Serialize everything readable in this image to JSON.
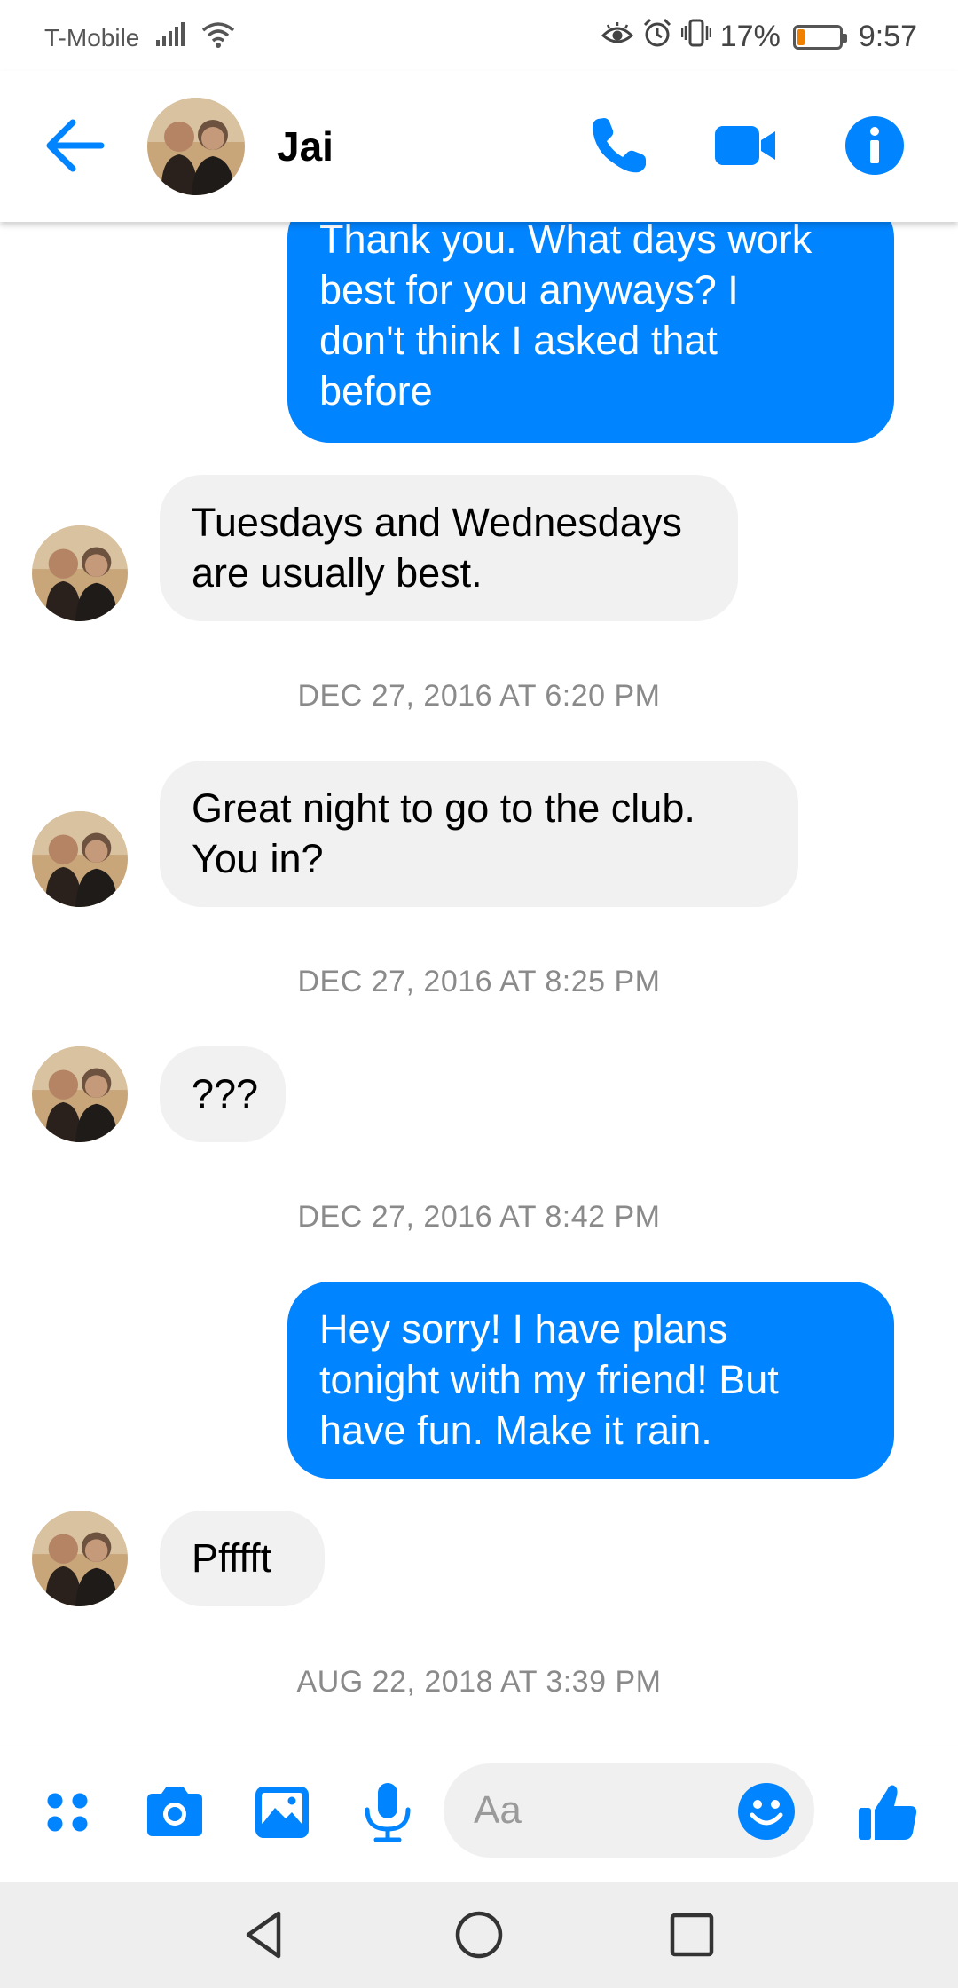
{
  "status_bar": {
    "carrier": "T-Mobile",
    "battery_percent": "17%",
    "time": "9:57",
    "battery_level": 0.17,
    "icons": [
      "signal-icon",
      "wifi-icon",
      "eye-comfort-icon",
      "alarm-icon",
      "vibrate-icon",
      "battery-icon"
    ]
  },
  "header": {
    "contact_name": "Jai",
    "icons": [
      "back-arrow-icon",
      "phone-icon",
      "video-camera-icon",
      "info-icon"
    ]
  },
  "messages": [
    {
      "direction": "outgoing",
      "lines": [
        "Thank you. What days work",
        "best for you anyways? I",
        "don't think I asked that",
        "before"
      ]
    },
    {
      "direction": "incoming",
      "lines": [
        "Tuesdays and Wednesdays",
        "are usually best."
      ]
    },
    {
      "timestamp": "DEC 27, 2016 AT 6:20 PM"
    },
    {
      "direction": "incoming",
      "lines": [
        "Great night to go to the club.",
        "You in?"
      ]
    },
    {
      "timestamp": "DEC 27, 2016 AT 8:25 PM"
    },
    {
      "direction": "incoming",
      "lines": [
        "???"
      ]
    },
    {
      "timestamp": "DEC 27, 2016 AT 8:42 PM"
    },
    {
      "direction": "outgoing",
      "lines": [
        "Hey sorry! I have plans",
        "tonight with my friend! But",
        "have fun. Make it rain."
      ]
    },
    {
      "direction": "incoming",
      "lines": [
        "Pfffft"
      ]
    },
    {
      "timestamp": "AUG 22, 2018 AT 3:39 PM"
    }
  ],
  "composer": {
    "placeholder": "Aa",
    "icons": [
      "apps-grid-icon",
      "camera-icon",
      "gallery-icon",
      "microphone-icon",
      "emoji-icon",
      "thumbs-up-icon"
    ]
  },
  "nav_bar": {
    "icons": [
      "back-triangle-icon",
      "home-circle-icon",
      "recents-square-icon"
    ]
  },
  "colors": {
    "accent": "#0084ff",
    "incoming_bubble": "#f1f1f1",
    "timestamp_text": "#8a8a8a",
    "battery_low": "#f08000"
  }
}
